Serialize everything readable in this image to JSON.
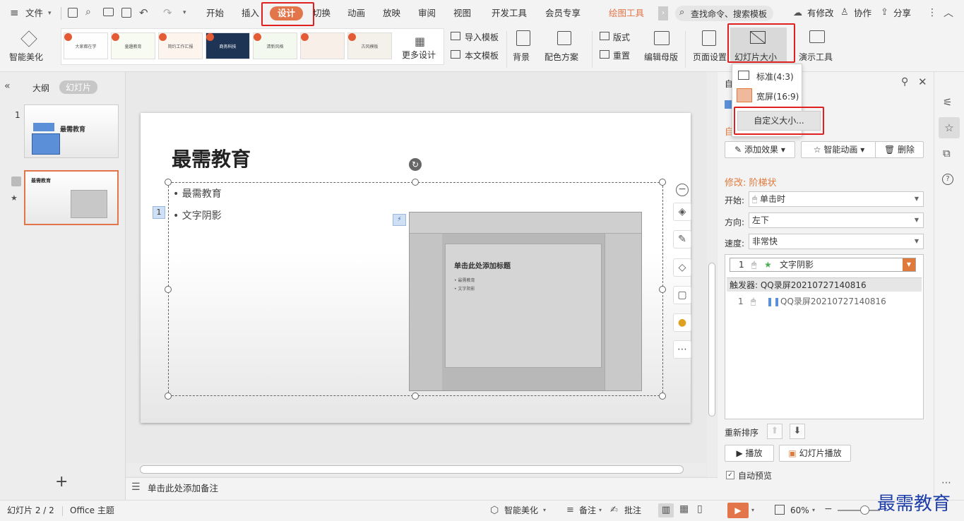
{
  "menu": {
    "file_label": "文件",
    "tabs": [
      "开始",
      "插入",
      "设计",
      "切换",
      "动画",
      "放映",
      "审阅",
      "视图",
      "开发工具",
      "会员专享",
      "绘图工具"
    ],
    "search_placeholder": "查找命令、搜索模板",
    "modified": "有修改",
    "collab": "协作",
    "share": "分享"
  },
  "ribbon": {
    "smart_beautify": "智能美化",
    "templates": [
      "大家都在学",
      "童趣教育",
      "简约工作汇报",
      "商务科技",
      "清新风格",
      "",
      "古风模板"
    ],
    "more_design": "更多设计",
    "import_template": "导入模板",
    "this_template": "本文模板",
    "background": "背景",
    "color_scheme": "配色方案",
    "layout": "版式",
    "reset": "重置",
    "edit_master": "编辑母版",
    "page_setup": "页面设置",
    "slide_size": "幻灯片大小",
    "present_tools": "演示工具"
  },
  "dropdown": {
    "standard": "标准(4:3)",
    "wide": "宽屏(16:9)",
    "custom": "自定义大小..."
  },
  "leftpane": {
    "outline_tab": "大纲",
    "slides_tab": "幻灯片",
    "slide1_num": "1",
    "slide1_title": "最需教育",
    "slide2_title": "最需教育",
    "add": "+"
  },
  "slide": {
    "title": "最需教育",
    "bullets": [
      "最需教育",
      "文字阴影"
    ],
    "anim_num": "1",
    "inner_title": "单击此处添加标题",
    "inner_bullets": [
      "最需教育",
      "文字阴影"
    ]
  },
  "notes": {
    "placeholder": "单击此处添加备注"
  },
  "rightpane": {
    "title": "自定义动画",
    "add_effect": "添加效果",
    "smart_anim": "智能动画",
    "delete": "删除",
    "modify": "修改: 阶梯状",
    "start_label": "开始:",
    "start_value": "单击时",
    "direction_label": "方向:",
    "direction_value": "左下",
    "speed_label": "速度:",
    "speed_value": "非常快",
    "item1_num": "1",
    "item1_text": "文字阴影",
    "trigger": "触发器: QQ录屏20210727140816",
    "item2_num": "1",
    "item2_text": "QQ录屏20210727140816",
    "reorder": "重新排序",
    "play": "播放",
    "slideshow": "幻灯片播放",
    "autopreview": "自动预览"
  },
  "status": {
    "slide_counter": "幻灯片 2 / 2",
    "theme": "Office 主题",
    "smart_beautify": "智能美化",
    "notes": "备注",
    "comments": "批注",
    "zoom": "60%",
    "watermark": "最需教育"
  },
  "colors": {
    "accent": "#e2754a",
    "highlight": "#e02020",
    "panel_orange": "#e07a3c"
  }
}
